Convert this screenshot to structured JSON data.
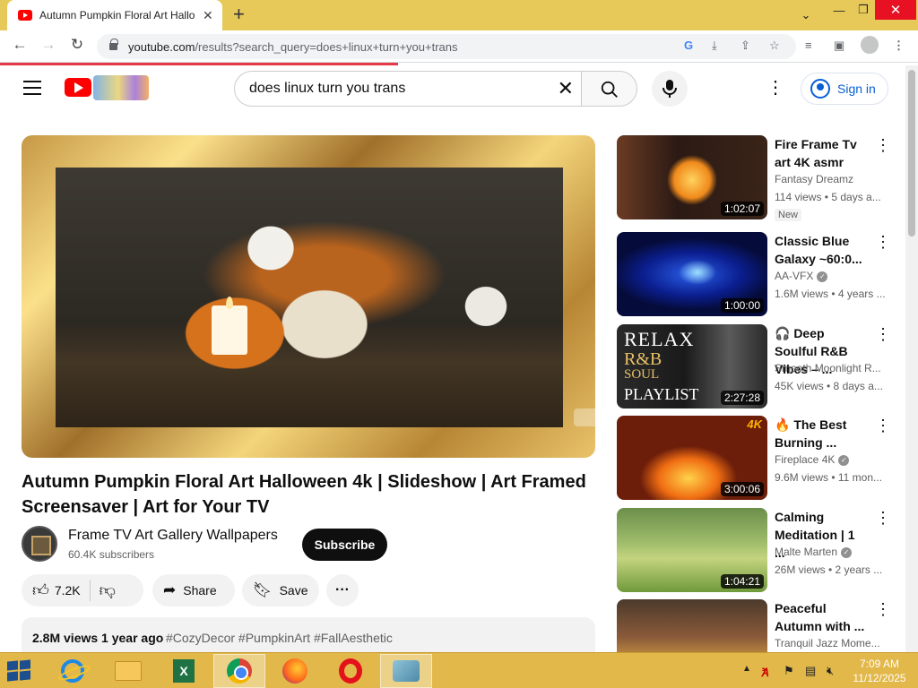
{
  "browser": {
    "tab_title": "Autumn Pumpkin Floral Art Hallo",
    "url_host": "youtube.com",
    "url_rest": "/results?search_query=does+linux+turn+you+trans"
  },
  "masthead": {
    "search_query": "does linux turn you trans",
    "sign_in_label": "Sign in"
  },
  "video": {
    "title": "Autumn Pumpkin Floral Art Halloween 4k | Slideshow | Art Framed Screensaver | Art for Your TV",
    "channel_name": "Frame TV Art Gallery Wallpapers",
    "subscribers": "60.4K subscribers",
    "subscribe_label": "Subscribe",
    "likes": "7.2K",
    "share_label": "Share",
    "save_label": "Save",
    "stats": "2.8M views  1 year ago",
    "hashtags": "#CozyDecor #PumpkinArt #FallAesthetic"
  },
  "recommendations": [
    {
      "title": "Fire Frame Tv art 4K asmr",
      "channel": "Fantasy Dreamz",
      "meta": "114 views • 5 days a...",
      "duration": "1:02:07",
      "badge": "New",
      "verified": false
    },
    {
      "title": "Classic Blue Galaxy ~60:0...",
      "channel": "AA-VFX",
      "meta": "1.6M views • 4 years ...",
      "duration": "1:00:00",
      "verified": true
    },
    {
      "title": "🎧 Deep Soulful R&B Vibes – ...",
      "channel": "Smooth Moonlight R...",
      "meta": "45K views • 8 days a...",
      "duration": "2:27:28",
      "verified": false,
      "thumb_text": [
        "RELAX",
        "R&B",
        "SOUL",
        "PLAYLIST"
      ]
    },
    {
      "title": "🔥 The Best Burning ...",
      "channel": "Fireplace 4K",
      "meta": "9.6M views • 11 mon...",
      "duration": "3:00:06",
      "verified": true,
      "thumb_text": [
        "4K"
      ]
    },
    {
      "title": "Calming Meditation | 1 ...",
      "channel": "Malte Marten",
      "meta": "26M views • 2 years ...",
      "duration": "1:04:21",
      "verified": true
    },
    {
      "title": "Peaceful Autumn with ...",
      "channel": "Tranquil Jazz Mome...",
      "meta": "",
      "duration": "",
      "verified": false
    }
  ],
  "taskbar": {
    "time": "7:09 AM",
    "date": "11/12/2025",
    "apps": [
      "internet-explorer",
      "file-explorer",
      "excel",
      "chrome",
      "firefox",
      "opera",
      "misc-app"
    ]
  },
  "colors": {
    "yt_red": "#ff0000",
    "link_blue": "#065fd4",
    "taskbar": "#e2b84a",
    "close_red": "#e81123"
  }
}
